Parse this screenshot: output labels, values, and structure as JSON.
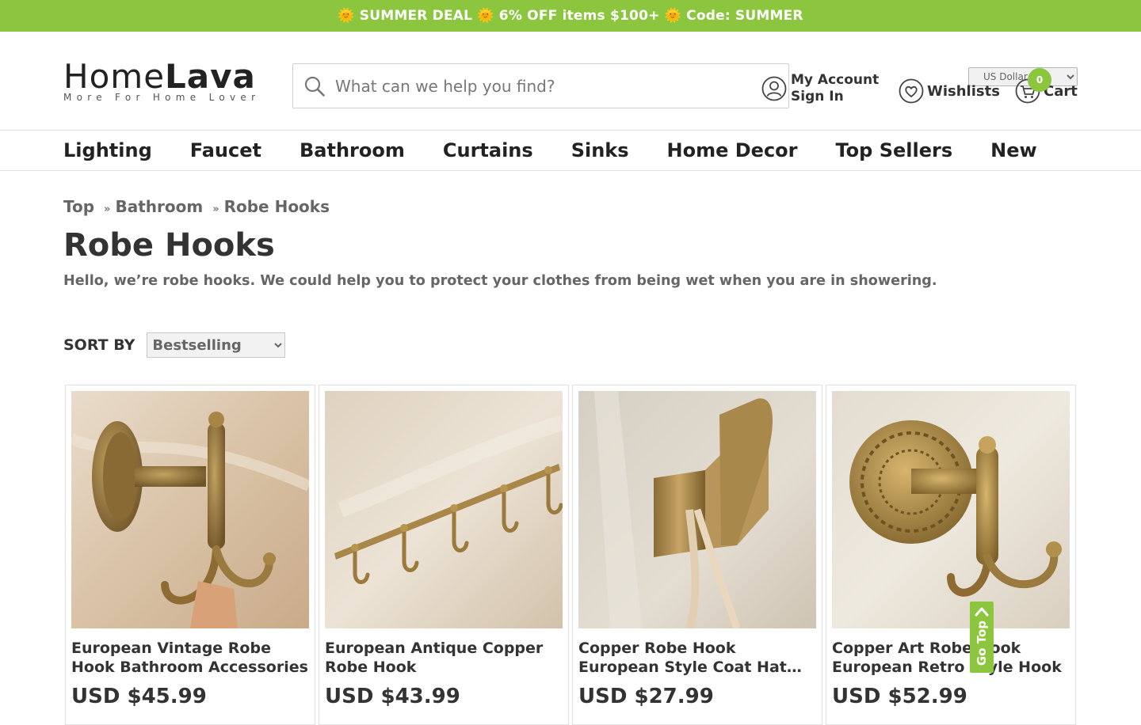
{
  "promo": {
    "text": "🌞 SUMMER DEAL 🌞 6% OFF items $100+ 🌞 Code: SUMMER"
  },
  "header": {
    "currency": "US Dollar",
    "logo": {
      "main_home": "Home",
      "main_lava": "Lava",
      "tagline": "More For Home Lover"
    },
    "search": {
      "placeholder": "What can we help you find?"
    },
    "account": {
      "line1": "My Account",
      "line2": "Sign In"
    },
    "wishlists": "Wishlists",
    "cart": {
      "label": "Cart",
      "count": "0"
    }
  },
  "nav": {
    "items": [
      "Lighting",
      "Faucet",
      "Bathroom",
      "Curtains",
      "Sinks",
      "Home Decor",
      "Top Sellers",
      "New"
    ]
  },
  "breadcrumb": {
    "top": "Top",
    "sep": "»",
    "category": "Bathroom",
    "current": "Robe Hooks"
  },
  "page": {
    "title": "Robe Hooks",
    "description": "Hello, we’re robe hooks. We could help you to protect your clothes from being wet when you are in showering."
  },
  "sort": {
    "label": "SORT BY",
    "selected": "Bestselling"
  },
  "products": [
    {
      "name": "European Vintage Robe Hook Bathroom Accessories",
      "price": "USD $45.99"
    },
    {
      "name": "European Antique Copper Robe Hook",
      "price": "USD $43.99"
    },
    {
      "name": "Copper Robe Hook European Style Coat Hat Hook",
      "price": "USD $27.99"
    },
    {
      "name": "Copper Art Robe Hook European Retro Style Hook",
      "price": "USD $52.99"
    }
  ],
  "gotop": {
    "label": "Go Top"
  },
  "colors": {
    "accent": "#8cc63f",
    "text": "#333333",
    "muted": "#666666"
  }
}
